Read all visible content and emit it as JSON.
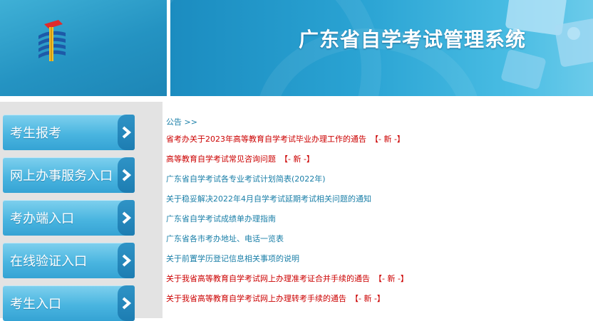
{
  "header": {
    "title": "广东省自学考试管理系统"
  },
  "sidebar": {
    "items": [
      {
        "label": "考生报考"
      },
      {
        "label": "网上办事服务入口"
      },
      {
        "label": "考办端入口"
      },
      {
        "label": "在线验证入口"
      },
      {
        "label": "考生入口"
      }
    ]
  },
  "notices": {
    "header": "公告 >>",
    "new_badge": "【- 新 -】",
    "items": [
      {
        "text": "省考办关于2023年高等教育自学考试毕业办理工作的通告",
        "color": "#cc0000",
        "is_new": true
      },
      {
        "text": "高等教育自学考试常见咨询问题",
        "color": "#cc0000",
        "is_new": true
      },
      {
        "text": "广东省自学考试各专业考试计划简表(2022年)",
        "color": "#1a7fa8",
        "is_new": false
      },
      {
        "text": "关于稳妥解决2022年4月自学考试延期考试相关问题的通知",
        "color": "#1a7fa8",
        "is_new": false
      },
      {
        "text": "广东省自学考试成绩单办理指南",
        "color": "#1a7fa8",
        "is_new": false
      },
      {
        "text": "广东省各市考办地址、电话一览表",
        "color": "#1a7fa8",
        "is_new": false
      },
      {
        "text": "关于前置学历登记信息相关事项的说明",
        "color": "#1a7fa8",
        "is_new": false
      },
      {
        "text": "关于我省高等教育自学考试网上办理准考证合并手续的通告",
        "color": "#cc0000",
        "is_new": true
      },
      {
        "text": "关于我省高等教育自学考试网上办理转考手续的通告",
        "color": "#cc0000",
        "is_new": true
      }
    ]
  },
  "colors": {
    "accent": "#2aa3d3",
    "notice_red": "#cc0000",
    "notice_blue": "#1a7fa8"
  }
}
